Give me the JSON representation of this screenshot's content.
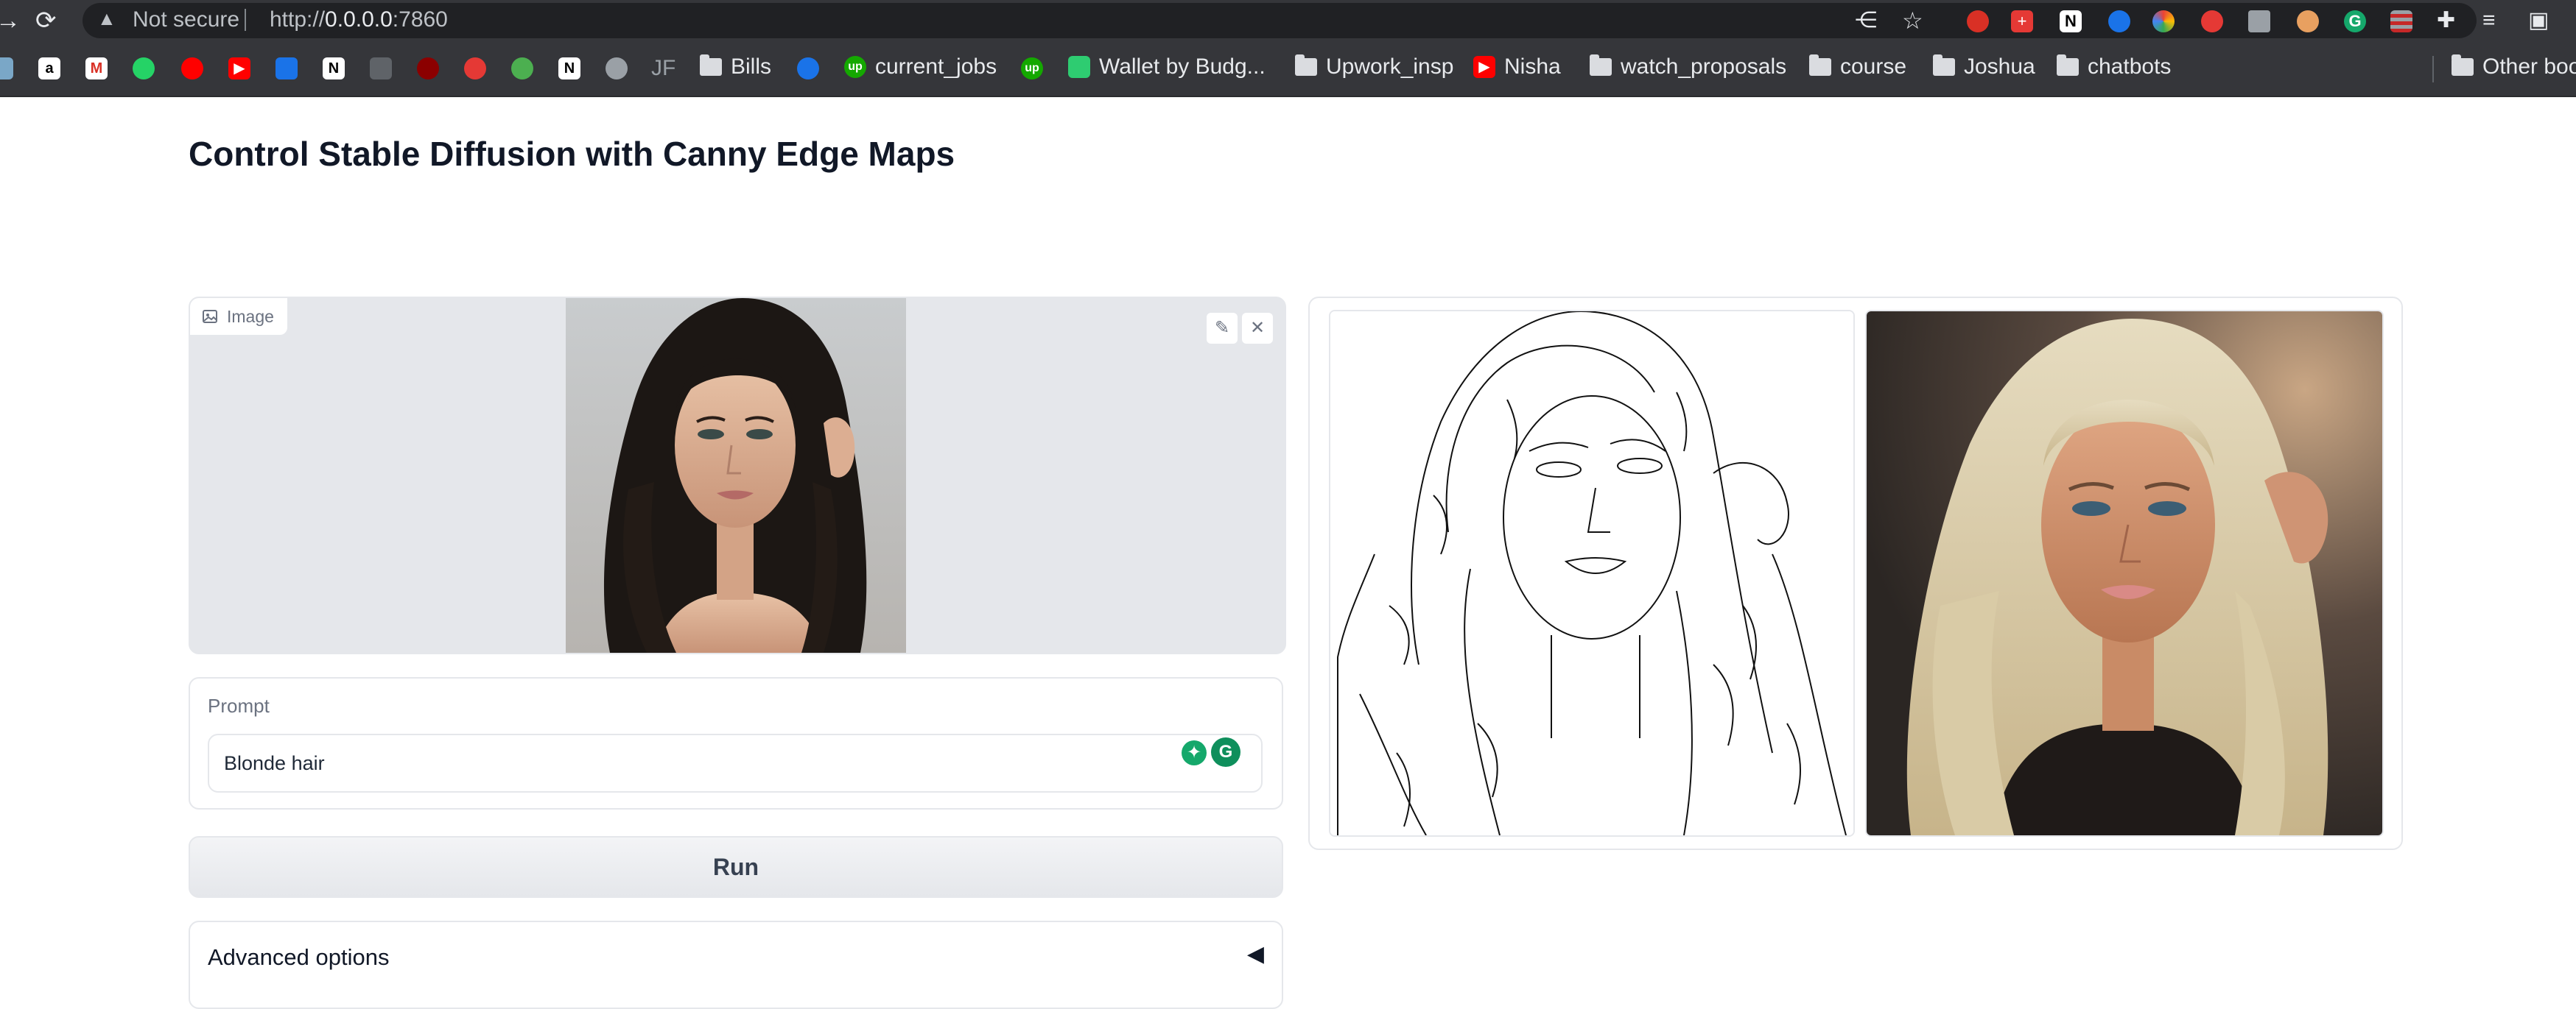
{
  "browser": {
    "security_label": "Not secure",
    "url_prefix": "http://",
    "url_host": "0.0.0.0",
    "url_port": ":7860",
    "extension_icons": [
      "share-icon",
      "star-icon",
      "ext-red-icon",
      "ext-swiss-icon",
      "notion-icon",
      "ext-blue-icon",
      "chrome-color-icon",
      "ext-red-hand-icon",
      "camera-icon",
      "cookie-icon",
      "grammarly-icon",
      "ext-flag-icon",
      "puzzle-icon",
      "playlist-icon",
      "sidebar-icon"
    ],
    "bookmarks": [
      {
        "label": "Bills",
        "icon": "folder-icon"
      },
      {
        "label": "current_jobs",
        "icon": "upwork-icon"
      },
      {
        "label": "Wallet by Budg...",
        "icon": "wallet-icon"
      },
      {
        "label": "Upwork_insp",
        "icon": "folder-icon"
      },
      {
        "label": "Nisha",
        "icon": "youtube-icon"
      },
      {
        "label": "watch_proposals",
        "icon": "folder-icon"
      },
      {
        "label": "course",
        "icon": "folder-icon"
      },
      {
        "label": "Joshua",
        "icon": "folder-icon"
      },
      {
        "label": "chatbots",
        "icon": "folder-icon"
      },
      {
        "label": "Other boo",
        "icon": "folder-icon"
      }
    ],
    "short_bookmark_text": "JF"
  },
  "page": {
    "title": "Control Stable Diffusion with Canny Edge Maps",
    "image_input": {
      "label": "Image",
      "edit_icon": "pencil-icon",
      "close_icon": "close-icon"
    },
    "prompt": {
      "label": "Prompt",
      "value": "Blonde hair",
      "placeholder": ""
    },
    "run_label": "Run",
    "advanced_label": "Advanced options",
    "advanced_caret": "◀"
  },
  "colors": {
    "chrome_bg": "#35363a",
    "panel_border": "#e5e7eb",
    "panel_fill": "#e5e7eb",
    "grammarly_green": "#15a86b"
  }
}
